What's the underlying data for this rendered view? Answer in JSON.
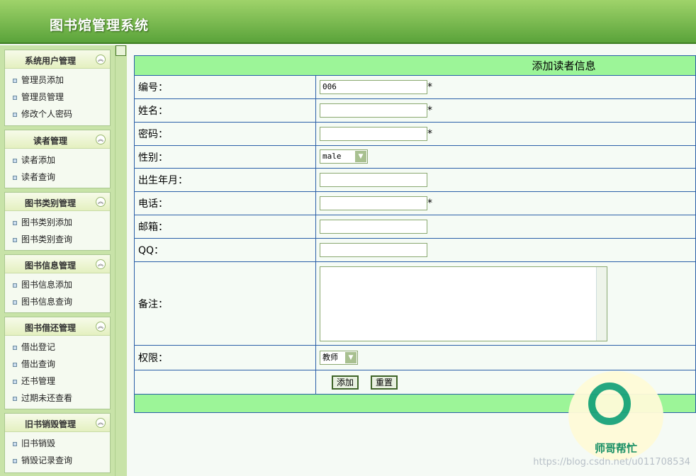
{
  "header": {
    "title": "图书馆管理系统"
  },
  "sidebar": {
    "menus": [
      {
        "title": "系统用户管理",
        "items": [
          "管理员添加",
          "管理员管理",
          "修改个人密码"
        ]
      },
      {
        "title": "读者管理",
        "items": [
          "读者添加",
          "读者查询"
        ]
      },
      {
        "title": "图书类别管理",
        "items": [
          "图书类别添加",
          "图书类别查询"
        ]
      },
      {
        "title": "图书信息管理",
        "items": [
          "图书信息添加",
          "图书信息查询"
        ]
      },
      {
        "title": "图书借还管理",
        "items": [
          "借出登记",
          "借出查询",
          "还书管理",
          "过期未还查看"
        ]
      },
      {
        "title": "旧书销毁管理",
        "items": [
          "旧书销毁",
          "销毁记录查询"
        ]
      }
    ]
  },
  "form": {
    "title": "添加读者信息",
    "labels": {
      "id": "编号：",
      "name": "姓名：",
      "password": "密码：",
      "gender": "性别：",
      "birth": "出生年月：",
      "phone": "电话：",
      "email": "邮箱：",
      "qq": "QQ：",
      "remark": "备注：",
      "permission": "权限："
    },
    "values": {
      "id": "006",
      "name": "",
      "password": "",
      "gender": "male",
      "birth": "",
      "phone": "",
      "email": "",
      "qq": "",
      "remark": "",
      "permission": "教师"
    },
    "required_mark": "*",
    "buttons": {
      "add": "添加",
      "reset": "重置"
    }
  },
  "watermark": {
    "logo_text": "师哥帮忙",
    "url": "https://blog.csdn.net/u011708534"
  },
  "colors": {
    "header": "#6db346",
    "form_head": "#9cf598",
    "border": "#2a5fa8"
  }
}
